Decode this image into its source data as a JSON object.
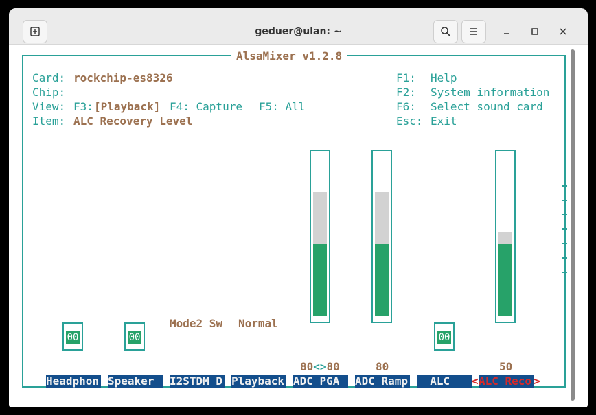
{
  "window": {
    "title": "geduer@ulan: ~",
    "new_tab_icon": "new-tab-icon",
    "search_icon": "search-icon",
    "menu_icon": "hamburger-menu-icon"
  },
  "alsamixer": {
    "title": "AlsaMixer v1.2.8",
    "card_label": "Card:",
    "card_value": "rockchip-es8326",
    "chip_label": "Chip:",
    "chip_value": "",
    "view_label": "View:",
    "view_f3_key": "F3:",
    "view_f3_value": "[Playback]",
    "view_f4": "F4: Capture",
    "view_f5": "F5: All",
    "item_label": "Item:",
    "item_value": "ALC Recovery Level",
    "help": [
      {
        "key": "F1:",
        "text": "Help"
      },
      {
        "key": "F2:",
        "text": "System information"
      },
      {
        "key": "F6:",
        "text": "Select sound card"
      },
      {
        "key": "Esc:",
        "text": "Exit"
      }
    ],
    "enum_control": {
      "name": "Mode2 Sw",
      "value": "Normal"
    },
    "switches": [
      {
        "value": "00"
      },
      {
        "value": "00"
      },
      {
        "value": "00"
      }
    ],
    "sliders": [
      {
        "value_text": "80<>80",
        "left_part": "80",
        "sep": "<>",
        "right_part": "80",
        "range_fraction": 0.78,
        "level_fraction": 0.45
      },
      {
        "value_text": "80",
        "range_fraction": 0.78,
        "level_fraction": 0.45
      },
      {
        "value_text": "50",
        "range_fraction": 0.53,
        "level_fraction": 0.45
      }
    ],
    "channels": [
      {
        "label": "Headphon"
      },
      {
        "label": "Speaker "
      },
      {
        "label": "I2STDM D"
      },
      {
        "label": "Playback"
      },
      {
        "label": "ADC PGA "
      },
      {
        "label": "ADC Ramp"
      },
      {
        "label": "  ALC   "
      },
      {
        "label": "ALC Reco",
        "selected": true,
        "open": "<",
        "close": ">"
      }
    ]
  },
  "colors": {
    "border": "#2aa198",
    "label_bg": "#134e8c",
    "fill": "#27a269",
    "range": "#d2d2d2",
    "selected_text": "#d62a2a",
    "heading": "#9c7150"
  }
}
